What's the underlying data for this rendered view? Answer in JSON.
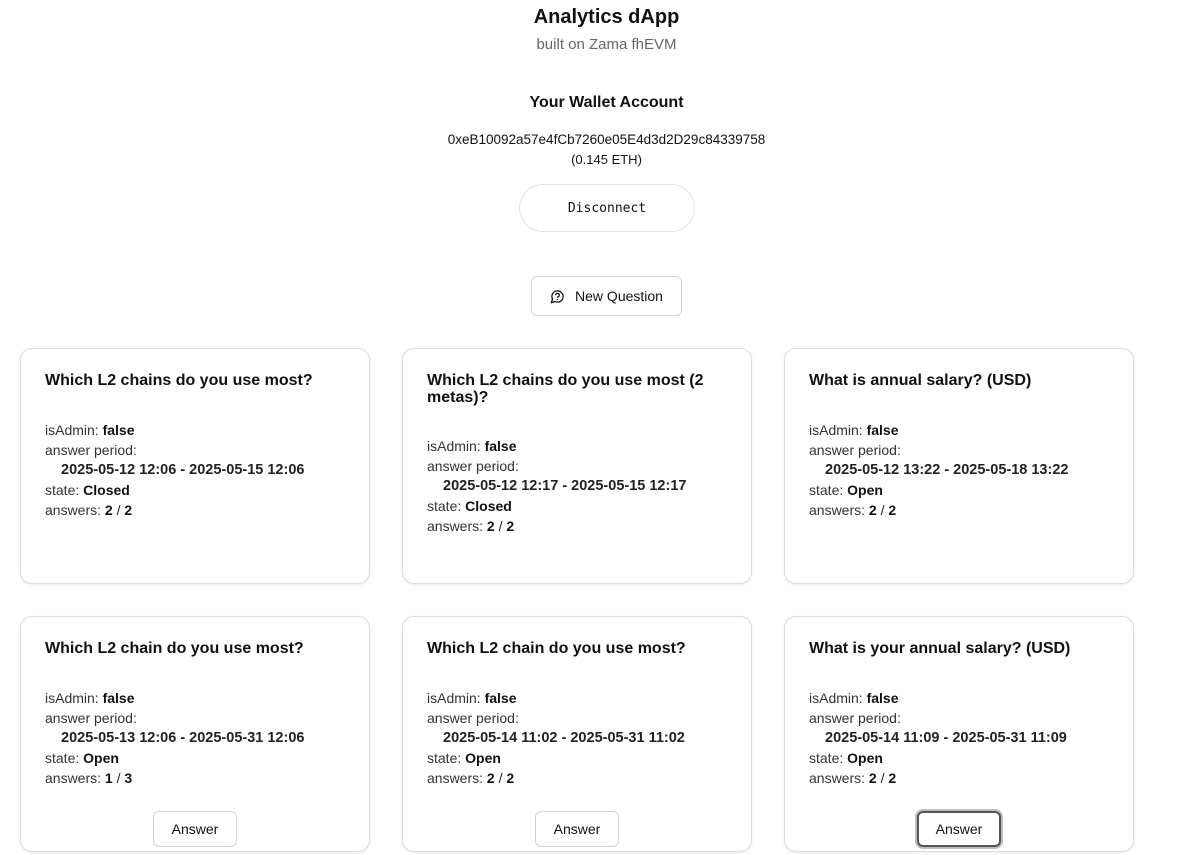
{
  "header": {
    "title": "Analytics dApp",
    "subtitle": "built on Zama fhEVM"
  },
  "wallet": {
    "heading": "Your Wallet Account",
    "address": "0xeB10092a57e4fCb7260e05E4d3d2D29c84339758",
    "balance": "(0.145 ETH)",
    "disconnect_label": "Disconnect"
  },
  "actions": {
    "new_question_label": "New Question",
    "new_question_icon": "message-circle-question-icon"
  },
  "labels": {
    "is_admin": "isAdmin:",
    "answer_period": "answer period:",
    "state": "state:",
    "answers": "answers:"
  },
  "cards": [
    {
      "title": "Which L2 chains do you use most?",
      "is_admin": "false",
      "period": "2025-05-12 12:06 - 2025-05-15 12:06",
      "state": "Closed",
      "answers_count": "2",
      "answers_sep": "/",
      "answers_total": "2"
    },
    {
      "title": "Which L2 chains do you use most (2 metas)?",
      "is_admin": "false",
      "period": "2025-05-12 12:17 - 2025-05-15 12:17",
      "state": "Closed",
      "answers_count": "2",
      "answers_sep": "/",
      "answers_total": "2"
    },
    {
      "title": "What is annual salary? (USD)",
      "is_admin": "false",
      "period": "2025-05-12 13:22 - 2025-05-18 13:22",
      "state": "Open",
      "answers_count": "2",
      "answers_sep": "/",
      "answers_total": "2"
    },
    {
      "title": "Which L2 chain do you use most?",
      "is_admin": "false",
      "period": "2025-05-13 12:06 - 2025-05-31 12:06",
      "state": "Open",
      "answers_count": "1",
      "answers_sep": "/",
      "answers_total": "3",
      "answer_label": "Answer"
    },
    {
      "title": "Which L2 chain do you use most?",
      "is_admin": "false",
      "period": "2025-05-14 11:02 - 2025-05-31 11:02",
      "state": "Open",
      "answers_count": "2",
      "answers_sep": "/",
      "answers_total": "2",
      "answer_label": "Answer"
    },
    {
      "title": "What is your annual salary? (USD)",
      "is_admin": "false",
      "period": "2025-05-14 11:09 - 2025-05-31 11:09",
      "state": "Open",
      "answers_count": "2",
      "answers_sep": "/",
      "answers_total": "2",
      "answer_label": "Answer"
    }
  ]
}
